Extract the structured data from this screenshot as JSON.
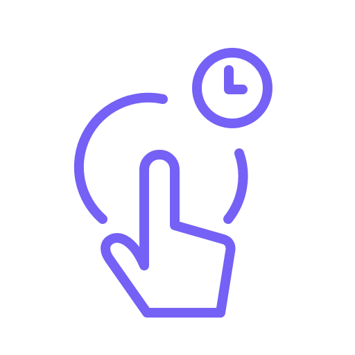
{
  "icon": {
    "name": "tap-and-hold-icon",
    "color": "#7561F5",
    "background": "#FFFFFF",
    "parts": [
      "touch-radius-arc",
      "pointing-hand",
      "clock-badge"
    ]
  }
}
